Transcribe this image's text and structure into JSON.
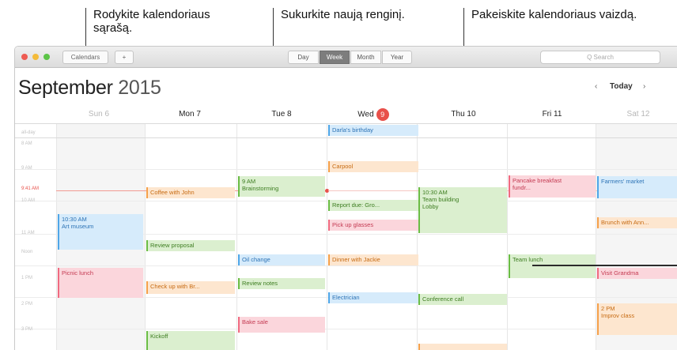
{
  "callouts": {
    "calendar_list": [
      "Rodykite kalendoriaus",
      "sąrašą."
    ],
    "new_event": "Sukurkite naują renginį.",
    "change_view": "Pakeiskite kalendoriaus vaizdą."
  },
  "toolbar": {
    "calendars_label": "Calendars",
    "add_label": "+",
    "views": [
      "Day",
      "Week",
      "Month",
      "Year"
    ],
    "active_view": "Week",
    "search_placeholder": "Q Search"
  },
  "header": {
    "month": "September",
    "year": "2015",
    "prev": "‹",
    "today": "Today",
    "next": "›"
  },
  "days": [
    {
      "label": "Sun 6",
      "weekend": true
    },
    {
      "label": "Mon 7",
      "weekend": false
    },
    {
      "label": "Tue 8",
      "weekend": false
    },
    {
      "label": "Wed",
      "badge": "9",
      "weekend": false
    },
    {
      "label": "Thu 10",
      "weekend": false
    },
    {
      "label": "Fri 11",
      "weekend": false
    },
    {
      "label": "Sat 12",
      "weekend": true
    }
  ],
  "time_labels": [
    "all-day",
    "8 AM",
    "9 AM",
    "9:41 AM",
    "10 AM",
    "11 AM",
    "Noon",
    "1 PM",
    "2 PM",
    "3 PM"
  ],
  "events": {
    "wed_birthday": "Darla's birthday",
    "wed_carpool": "Carpool",
    "wed_report": "Report due: Gro...",
    "wed_pickup": "Pick up glasses",
    "wed_dinner": "Dinner with Jackie",
    "wed_electrician": "Electrician",
    "mon_coffee": "Coffee with John",
    "mon_review": "Review proposal",
    "mon_checkup": "Check up with Br...",
    "mon_kickoff": "Kickoff",
    "tue_brainstorm_time": "9 AM",
    "tue_brainstorm": "Brainstorming",
    "tue_oil": "Oil change",
    "tue_notes": "Review notes",
    "tue_bake": "Bake sale",
    "thu_team_time": "10:30 AM",
    "thu_team_1": "Team building",
    "thu_team_2": "Lobby",
    "thu_conf": "Conference call",
    "fri_breakfast_1": "Pancake breakfast",
    "fri_breakfast_2": "fundr...",
    "fri_lunch": "Team lunch",
    "sat_market": "Farmers' market",
    "sat_brunch": "Brunch with Ann...",
    "sat_visit": "Visit Grandma",
    "sat_class_time": "2 PM",
    "sat_class": "Improv class",
    "sun_museum_time": "10:30 AM",
    "sun_museum": "Art museum",
    "sun_picnic": "Picnic lunch"
  }
}
